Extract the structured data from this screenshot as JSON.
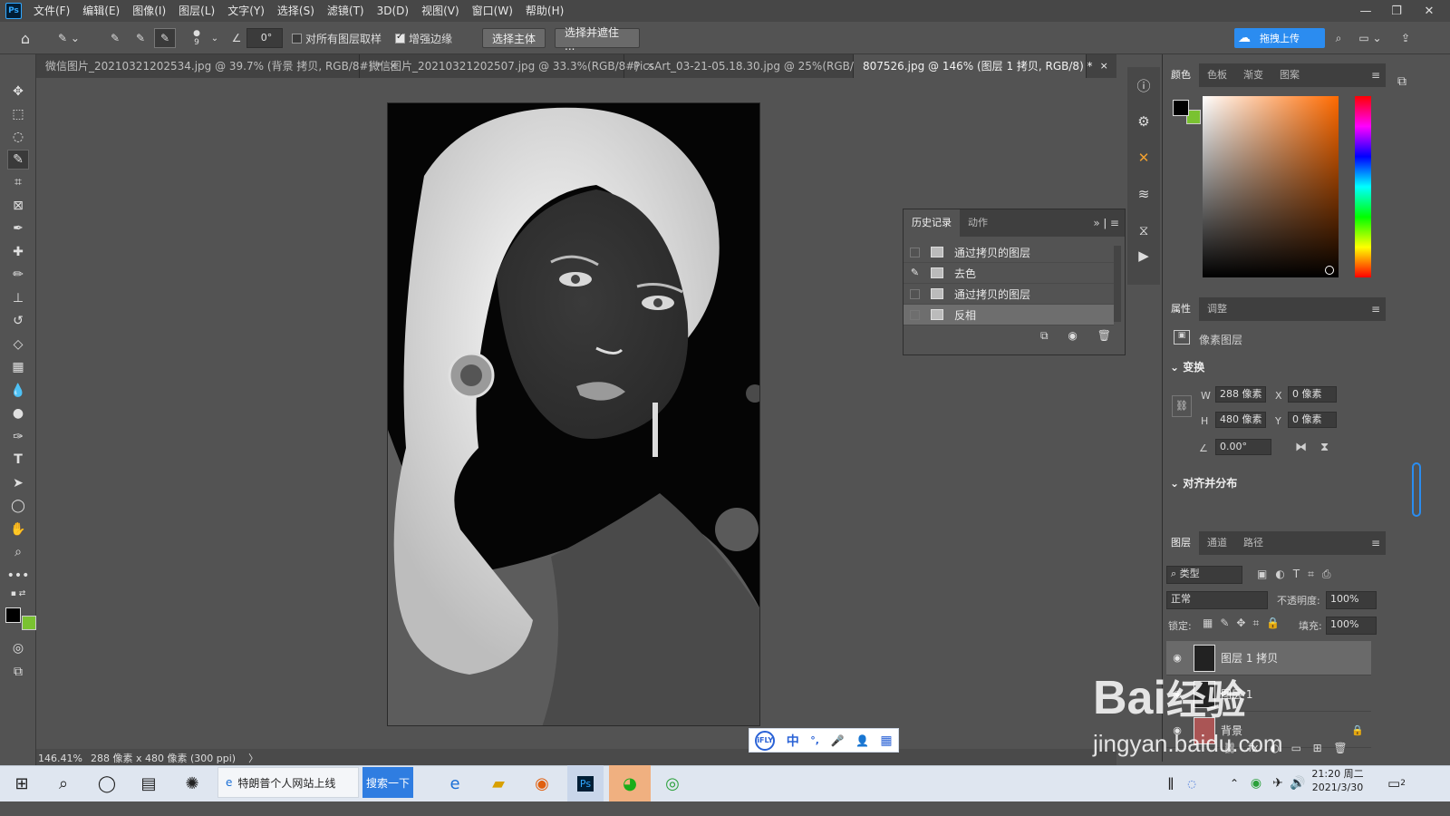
{
  "app": {
    "logo": "Ps"
  },
  "menu": [
    "文件(F)",
    "编辑(E)",
    "图像(I)",
    "图层(L)",
    "文字(Y)",
    "选择(S)",
    "滤镜(T)",
    "3D(D)",
    "视图(V)",
    "窗口(W)",
    "帮助(H)"
  ],
  "window_controls": {
    "minimize": "—",
    "restore": "❐",
    "close": "✕"
  },
  "options": {
    "brush_size": "9",
    "angle": "0°",
    "sample_all_layers": {
      "label": "对所有图层取样",
      "checked": false
    },
    "enhance_edge": {
      "label": "增强边缘",
      "checked": true
    },
    "select_subject": "选择主体",
    "select_and_mask": "选择并遮住 ...",
    "upload_label": "拖拽上传"
  },
  "tabs": [
    {
      "label": "微信图片_20210321202534.jpg @ 39.7% (背景 拷贝, RGB/8#) *",
      "close": "×"
    },
    {
      "label": "微信图片_20210321202507.jpg @ 33.3%(RGB/8#)",
      "close": "×"
    },
    {
      "label": "PicsArt_03-21-05.18.30.jpg @ 25%(RGB/8)",
      "close": "×"
    },
    {
      "label": "807526.jpg @ 146% (图层 1 拷贝, RGB/8) *",
      "close": "×",
      "active": true
    }
  ],
  "history_panel": {
    "tabs": [
      "历史记录",
      "动作"
    ],
    "items": [
      {
        "label": "通过拷贝的图层",
        "brush": false
      },
      {
        "label": "去色",
        "brush": true
      },
      {
        "label": "通过拷贝的图层",
        "brush": false
      },
      {
        "label": "反相",
        "brush": false,
        "selected": true
      }
    ]
  },
  "color_panel": {
    "tabs": [
      "颜色",
      "色板",
      "渐变",
      "图案"
    ],
    "foreground": "#000000",
    "background": "#7ac231"
  },
  "properties_panel": {
    "tabs": [
      "属性",
      "调整"
    ],
    "kind": "像素图层",
    "transform_title": "变换",
    "w_label": "W",
    "w": "288 像素",
    "h_label": "H",
    "h": "480 像素",
    "x_label": "X",
    "x": "0 像素",
    "y_label": "Y",
    "y": "0 像素",
    "angle": "0.00°",
    "align_title": "对齐并分布"
  },
  "layers_panel": {
    "tabs": [
      "图层",
      "通道",
      "路径"
    ],
    "filter": "类型",
    "blend_mode": "正常",
    "opacity_label": "不透明度:",
    "opacity": "100%",
    "lock_label": "锁定:",
    "fill_label": "填充:",
    "fill": "100%",
    "layers": [
      {
        "name": "图层 1 拷贝",
        "selected": true
      },
      {
        "name": "图层 1",
        "selected": false
      },
      {
        "name": "背景",
        "selected": false,
        "locked": true
      }
    ]
  },
  "status": {
    "zoom": "146.41%",
    "doc_info": "288 像素 x 480 像素 (300 ppi)",
    "arrow": "〉"
  },
  "ime": [
    "中",
    "°,",
    "🎤",
    "👤",
    "▦"
  ],
  "ime_logo": "iFLY",
  "taskbar": {
    "search_text": "特朗普个人网站上线",
    "search_button": "搜索一下",
    "time": "21:20 周二",
    "date": "2021/3/30",
    "notif_count": "2"
  },
  "watermark": {
    "line1": "Bai",
    "line1b": "经验",
    "line2": "jingyan.baidu.com"
  }
}
